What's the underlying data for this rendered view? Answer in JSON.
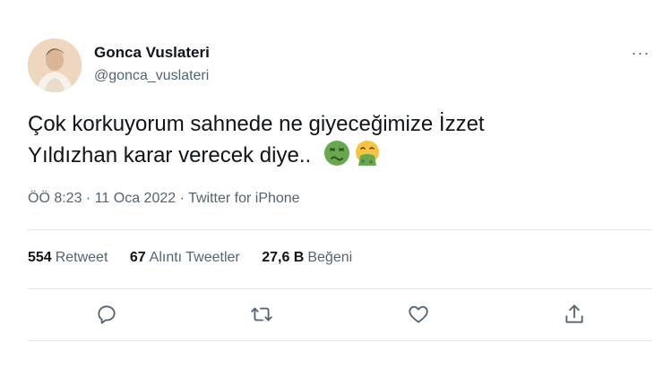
{
  "author": {
    "display_name": "Gonca Vuslateri",
    "handle": "@gonca_vuslateri"
  },
  "more_menu_glyph": "···",
  "tweet": {
    "text_line1": "Çok korkuyorum sahnede ne giyeceğimize İzzet",
    "text_line2": "Yıldızhan karar verecek diye..",
    "emojis": [
      "nauseated-face",
      "face-vomiting"
    ]
  },
  "meta": {
    "time": "ÖÖ 8:23",
    "sep1": " · ",
    "date": "11 Oca 2022",
    "sep2": " · ",
    "source": "Twitter for iPhone"
  },
  "stats": {
    "retweets_num": "554",
    "retweets_label": "Retweet",
    "quotes_num": "67",
    "quotes_label": "Alıntı Tweetler",
    "likes_num": "27,6 B",
    "likes_label": "Beğeni"
  },
  "actions": [
    "reply-icon",
    "retweet-icon",
    "like-icon",
    "share-icon"
  ],
  "colors": {
    "text": "#0f1419",
    "secondary": "#536471",
    "divider": "#e3e7ea",
    "emoji_green": "#6aa84f"
  }
}
